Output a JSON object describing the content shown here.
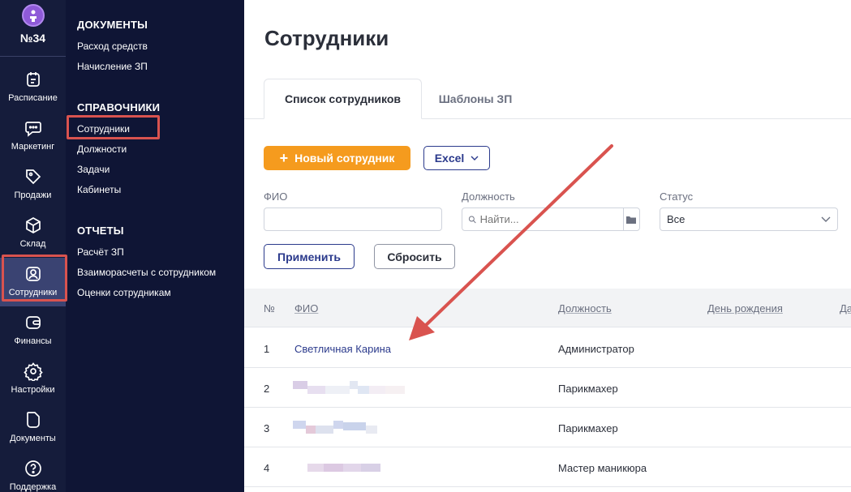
{
  "rail": {
    "org_label": "№34",
    "items": [
      {
        "label": "Расписание",
        "icon": "calendar-icon"
      },
      {
        "label": "Маркетинг",
        "icon": "chat-icon"
      },
      {
        "label": "Продажи",
        "icon": "tag-icon"
      },
      {
        "label": "Склад",
        "icon": "box-icon"
      },
      {
        "label": "Сотрудники",
        "icon": "user-icon"
      },
      {
        "label": "Финансы",
        "icon": "wallet-icon"
      },
      {
        "label": "Настройки",
        "icon": "gear-icon"
      },
      {
        "label": "Документы",
        "icon": "document-icon"
      },
      {
        "label": "Поддержка",
        "icon": "help-icon"
      }
    ]
  },
  "submenu": {
    "sections": [
      {
        "title": "ДОКУМЕНТЫ",
        "links": [
          "Расход средств",
          "Начисление ЗП"
        ]
      },
      {
        "title": "СПРАВОЧНИКИ",
        "links": [
          "Сотрудники",
          "Должности",
          "Задачи",
          "Кабинеты"
        ]
      },
      {
        "title": "ОТЧЕТЫ",
        "links": [
          "Расчёт ЗП",
          "Взаиморасчеты с сотрудником",
          "Оценки сотрудникам"
        ]
      }
    ]
  },
  "main": {
    "title": "Сотрудники",
    "tabs": [
      {
        "label": "Список сотрудников",
        "active": true
      },
      {
        "label": "Шаблоны ЗП",
        "active": false
      }
    ],
    "new_button": "Новый сотрудник",
    "excel_button": "Excel",
    "filters": {
      "fio_label": "ФИО",
      "fio_value": "",
      "position_label": "Должность",
      "position_placeholder": "Найти...",
      "status_label": "Статус",
      "status_value": "Все"
    },
    "apply_button": "Применить",
    "reset_button": "Сбросить",
    "table": {
      "headers": [
        "№",
        "ФИО",
        "Должность",
        "День рождения",
        "Да"
      ],
      "rows": [
        {
          "num": "1",
          "name": "Светличная Карина",
          "position": "Администратор"
        },
        {
          "num": "2",
          "name": "",
          "position": "Парикмахер"
        },
        {
          "num": "3",
          "name": "",
          "position": "Парикмахер"
        },
        {
          "num": "4",
          "name": "",
          "position": "Мастер маникюра"
        }
      ]
    }
  },
  "colors": {
    "rail_bg": "#151c3b",
    "submenu_bg": "#0f1535",
    "accent_orange": "#f59b1e",
    "primary_blue": "#2b3a8c",
    "annotation_red": "#d9534f"
  }
}
